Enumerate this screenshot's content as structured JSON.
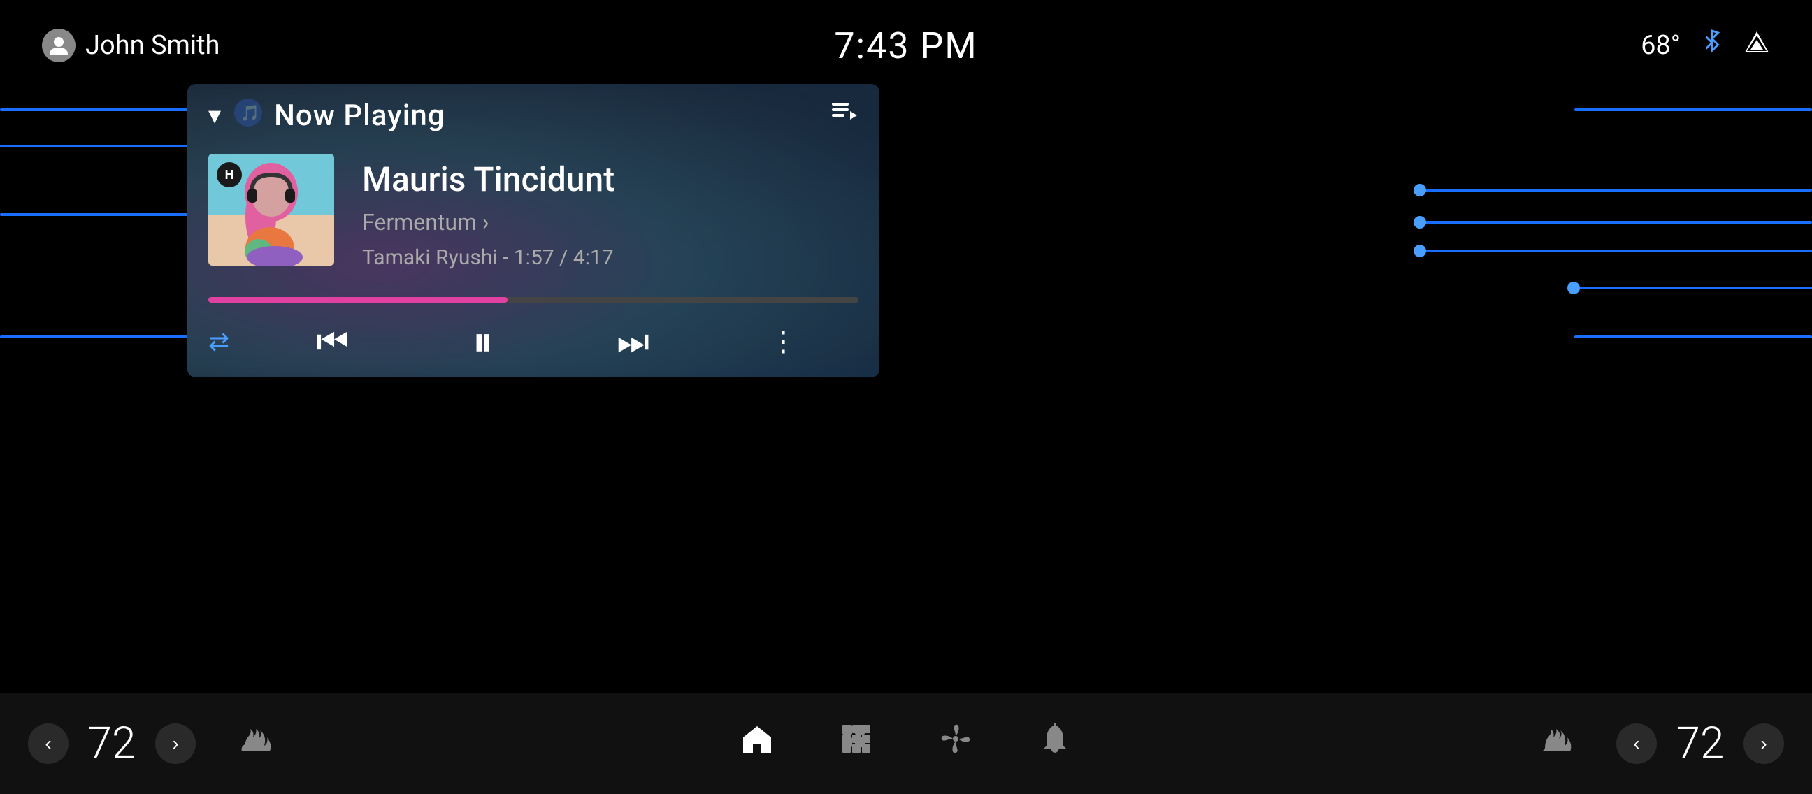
{
  "statusBar": {
    "user": "John Smith",
    "time": "7:43 PM",
    "temp": "68°",
    "icons": [
      "bluetooth",
      "signal"
    ]
  },
  "header": {
    "title": "Now Playing",
    "chevronLabel": "▾",
    "musicNote": "🎵"
  },
  "track": {
    "name": "Mauris Tincidunt",
    "album": "Fermentum",
    "artistTime": "Tamaki Ryushi - 1:57 / 4:17",
    "progressPercent": 46,
    "progressFilled": "46%"
  },
  "controls": {
    "repeatLabel": "⇄",
    "prevLabel": "⏮",
    "pauseLabel": "⏸",
    "nextLabel": "⏭",
    "moreLabel": "⋮"
  },
  "bottomBar": {
    "leftTemp": "72",
    "rightTemp": "72",
    "leftTempDecrease": "‹",
    "leftTempIncrease": "›",
    "rightTempDecrease": "‹",
    "rightTempIncrease": "›",
    "icons": {
      "heaterLeft": "heater-left",
      "home": "home",
      "apps": "apps",
      "fan": "fan",
      "bell": "bell",
      "heaterRight": "heater-right"
    }
  },
  "albumArt": {
    "headphoneBadge": "H"
  }
}
